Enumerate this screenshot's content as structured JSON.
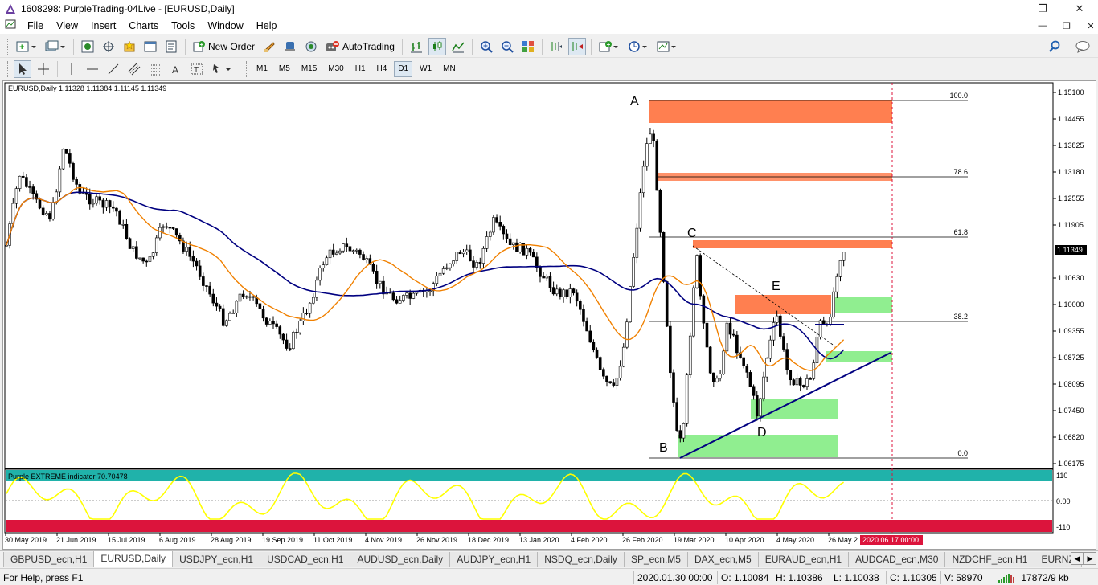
{
  "window": {
    "title": "1608298: PurpleTrading-04Live - [EURUSD,Daily]"
  },
  "menu": [
    "File",
    "View",
    "Insert",
    "Charts",
    "Tools",
    "Window",
    "Help"
  ],
  "toolbar": {
    "new_order": "New Order",
    "auto_trading": "AutoTrading"
  },
  "timeframes": [
    "M1",
    "M5",
    "M15",
    "M30",
    "H1",
    "H4",
    "D1",
    "W1",
    "MN"
  ],
  "active_timeframe": "D1",
  "chart": {
    "symbol_info": "EURUSD,Daily  1.11328 1.11384 1.11145 1.11349",
    "price_axis": [
      "1.15100",
      "1.14455",
      "1.13825",
      "1.13180",
      "1.12555",
      "1.11905",
      "1.11349",
      "1.10630",
      "1.10000",
      "1.09355",
      "1.08725",
      "1.08095",
      "1.07450",
      "1.06820",
      "1.06175"
    ],
    "current_price": "1.11349",
    "time_axis": [
      "30 May 2019",
      "21 Jun 2019",
      "15 Jul 2019",
      "6 Aug 2019",
      "28 Aug 2019",
      "19 Sep 2019",
      "11 Oct 2019",
      "4 Nov 2019",
      "26 Nov 2019",
      "18 Dec 2019",
      "13 Jan 2020",
      "4 Feb 2020",
      "26 Feb 2020",
      "19 Mar 2020",
      "10 Apr 2020",
      "4 May 2020",
      "26 May 2"
    ],
    "time_marker": "2020.06.17 00:00",
    "fib_levels": [
      "100.0",
      "78.6",
      "61.8",
      "38.2",
      "0.0"
    ],
    "wave_labels": [
      "A",
      "B",
      "C",
      "D",
      "E"
    ],
    "indicator": {
      "label": "Purple EXTREME indicator 70.70478",
      "scale": [
        "110",
        "0.00",
        "-110"
      ]
    },
    "colors": {
      "zone_red": "#FF7F50",
      "zone_green": "#90EE90",
      "ma_fast": "#F08000",
      "ma_slow": "#000080",
      "indicator_line": "#FFFF00",
      "indicator_top": "#20B2AA",
      "indicator_bottom": "#DC143C",
      "price_marker": "#DC143C"
    }
  },
  "tabs": [
    "GBPUSD_ecn,H1",
    "EURUSD,Daily",
    "USDJPY_ecn,H1",
    "USDCAD_ecn,H1",
    "AUDUSD_ecn,Daily",
    "AUDJPY_ecn,H1",
    "NSDQ_ecn,Daily",
    "SP_ecn,M5",
    "DAX_ecn,M5",
    "EURAUD_ecn,H1",
    "AUDCAD_ecn,M30",
    "NZDCHF_ecn,H1",
    "EURNZD_"
  ],
  "active_tab": "EURUSD,Daily",
  "status": {
    "help": "For Help, press F1",
    "datetime": "2020.01.30 00:00",
    "open": "O: 1.10084",
    "high": "H: 1.10386",
    "low": "L: 1.10038",
    "close": "C: 1.10305",
    "volume": "V: 58970",
    "traffic": "17872/9 kb"
  }
}
